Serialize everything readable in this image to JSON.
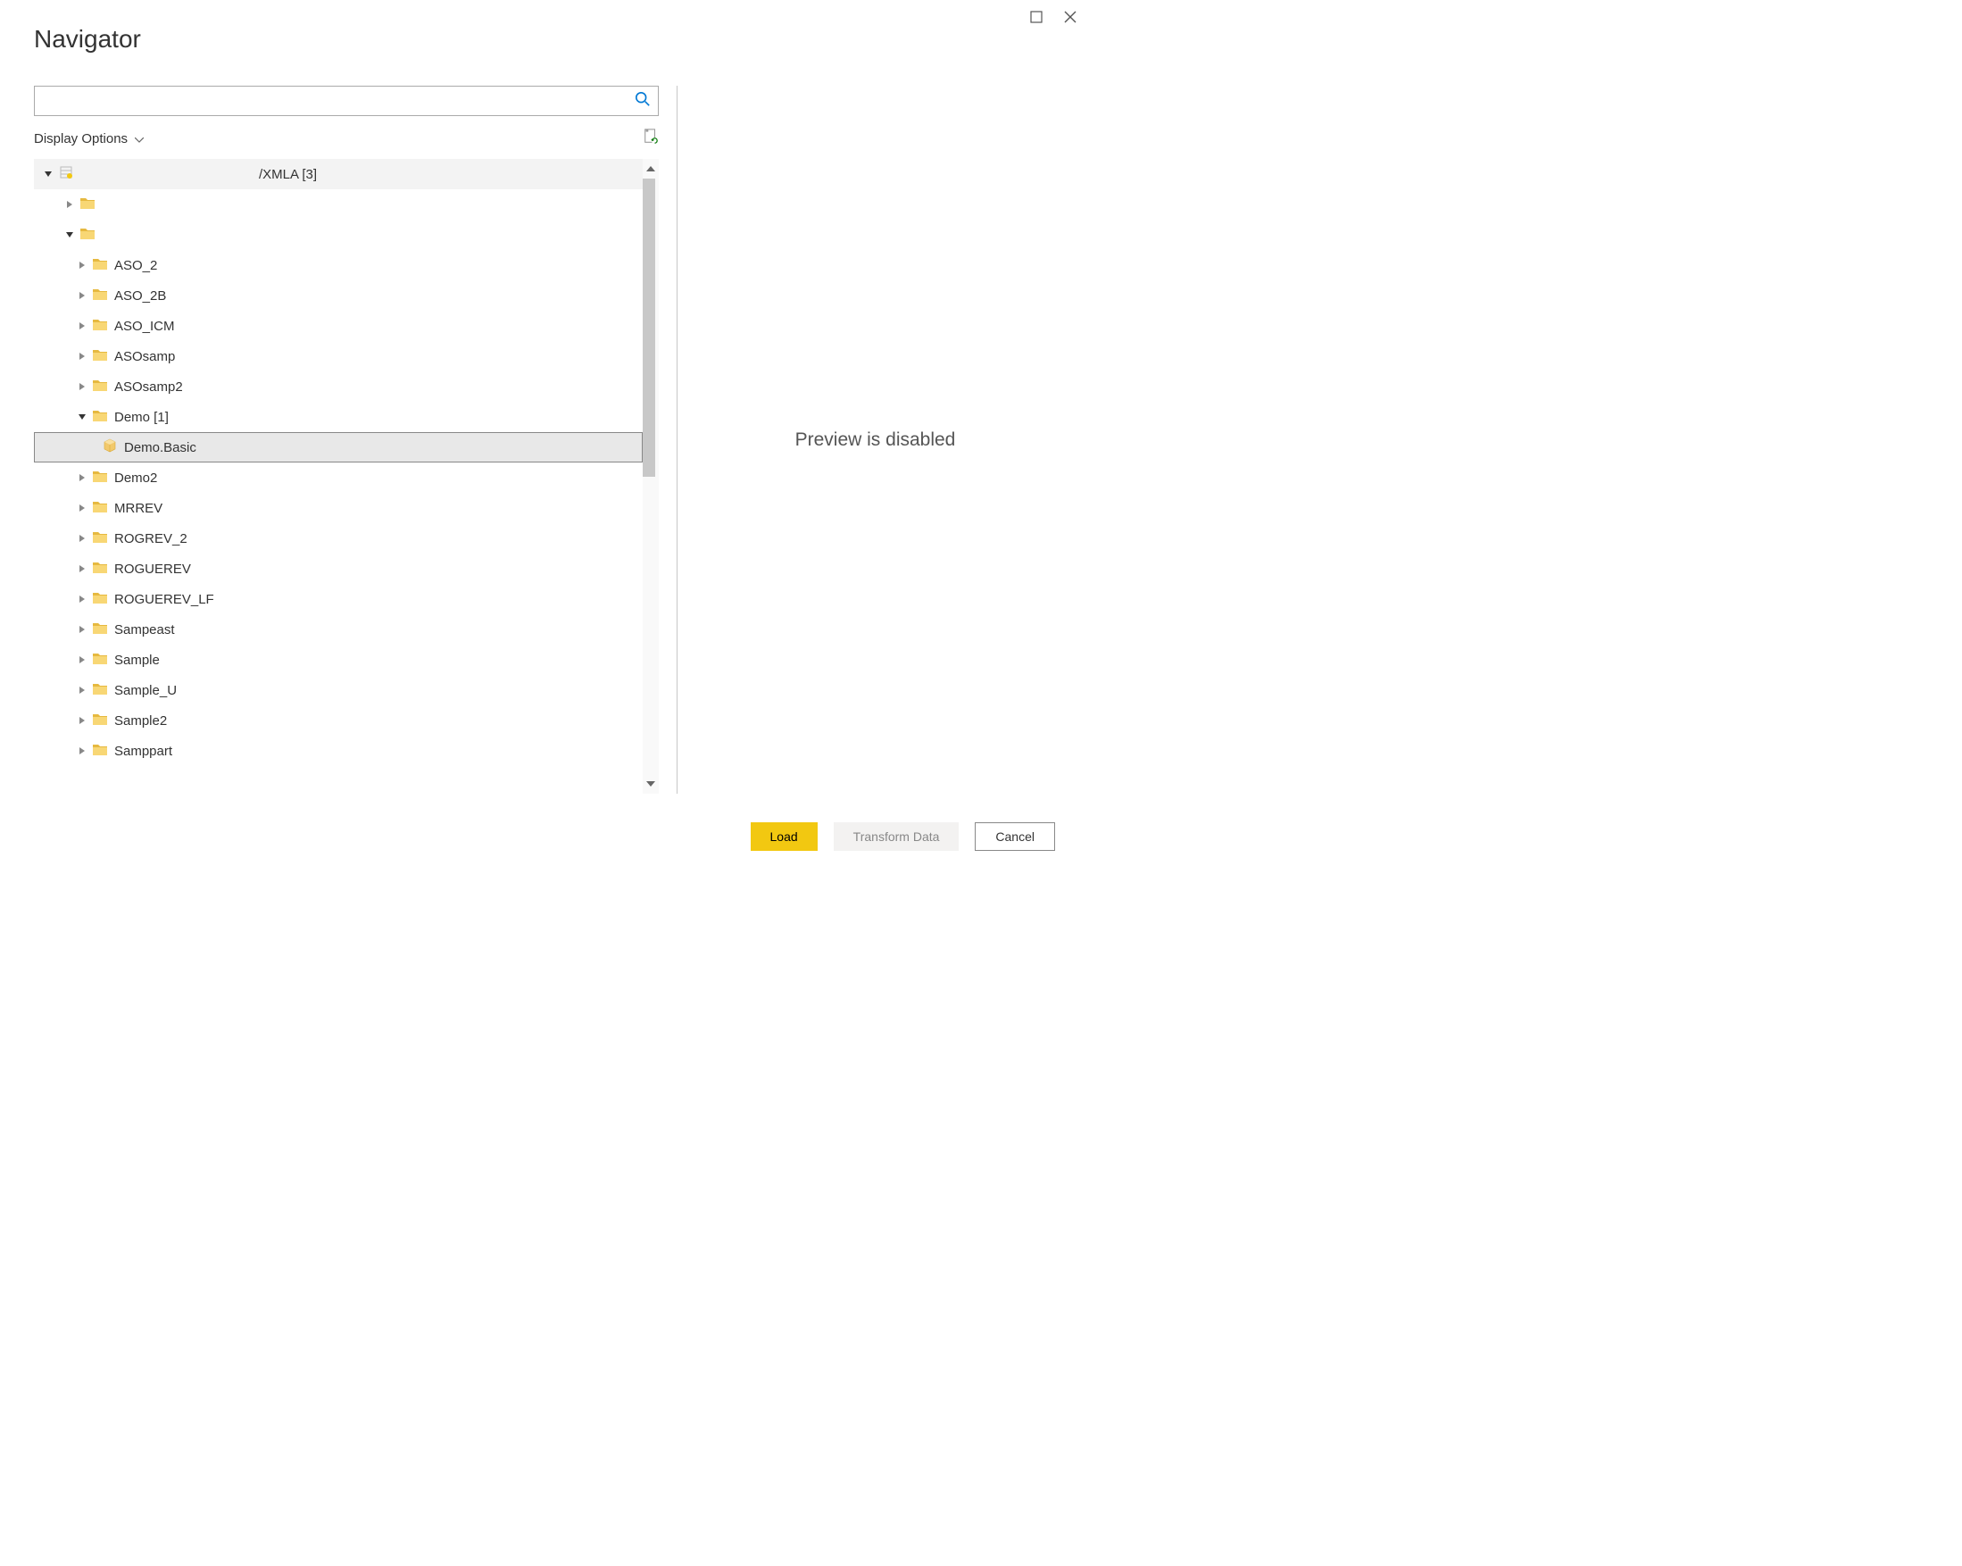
{
  "window": {
    "title": "Navigator"
  },
  "search": {
    "value": "",
    "placeholder": ""
  },
  "display_options": {
    "label": "Display Options"
  },
  "tree": {
    "root": {
      "label": "/XMLA [3]"
    },
    "blank1": {
      "label": ""
    },
    "blank2": {
      "label": ""
    },
    "items": [
      {
        "label": "ASO_2"
      },
      {
        "label": "ASO_2B"
      },
      {
        "label": "ASO_ICM"
      },
      {
        "label": "ASOsamp"
      },
      {
        "label": "ASOsamp2"
      }
    ],
    "demo_parent": {
      "label": "Demo [1]"
    },
    "demo_child": {
      "label": "Demo.Basic"
    },
    "items2": [
      {
        "label": "Demo2"
      },
      {
        "label": "MRREV"
      },
      {
        "label": "ROGREV_2"
      },
      {
        "label": "ROGUEREV"
      },
      {
        "label": "ROGUEREV_LF"
      },
      {
        "label": "Sampeast"
      },
      {
        "label": "Sample"
      },
      {
        "label": "Sample_U"
      },
      {
        "label": "Sample2"
      },
      {
        "label": "Samppart"
      }
    ]
  },
  "preview": {
    "text": "Preview is disabled"
  },
  "footer": {
    "load": "Load",
    "transform": "Transform Data",
    "cancel": "Cancel"
  }
}
